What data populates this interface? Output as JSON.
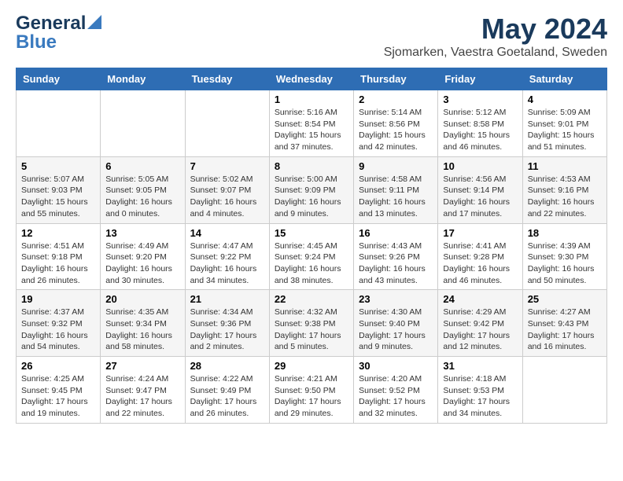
{
  "header": {
    "logo_general": "General",
    "logo_blue": "Blue",
    "main_title": "May 2024",
    "subtitle": "Sjomarken, Vaestra Goetaland, Sweden"
  },
  "weekdays": [
    "Sunday",
    "Monday",
    "Tuesday",
    "Wednesday",
    "Thursday",
    "Friday",
    "Saturday"
  ],
  "weeks": [
    [
      {
        "day": "",
        "info": ""
      },
      {
        "day": "",
        "info": ""
      },
      {
        "day": "",
        "info": ""
      },
      {
        "day": "1",
        "info": "Sunrise: 5:16 AM\nSunset: 8:54 PM\nDaylight: 15 hours and 37 minutes."
      },
      {
        "day": "2",
        "info": "Sunrise: 5:14 AM\nSunset: 8:56 PM\nDaylight: 15 hours and 42 minutes."
      },
      {
        "day": "3",
        "info": "Sunrise: 5:12 AM\nSunset: 8:58 PM\nDaylight: 15 hours and 46 minutes."
      },
      {
        "day": "4",
        "info": "Sunrise: 5:09 AM\nSunset: 9:01 PM\nDaylight: 15 hours and 51 minutes."
      }
    ],
    [
      {
        "day": "5",
        "info": "Sunrise: 5:07 AM\nSunset: 9:03 PM\nDaylight: 15 hours and 55 minutes."
      },
      {
        "day": "6",
        "info": "Sunrise: 5:05 AM\nSunset: 9:05 PM\nDaylight: 16 hours and 0 minutes."
      },
      {
        "day": "7",
        "info": "Sunrise: 5:02 AM\nSunset: 9:07 PM\nDaylight: 16 hours and 4 minutes."
      },
      {
        "day": "8",
        "info": "Sunrise: 5:00 AM\nSunset: 9:09 PM\nDaylight: 16 hours and 9 minutes."
      },
      {
        "day": "9",
        "info": "Sunrise: 4:58 AM\nSunset: 9:11 PM\nDaylight: 16 hours and 13 minutes."
      },
      {
        "day": "10",
        "info": "Sunrise: 4:56 AM\nSunset: 9:14 PM\nDaylight: 16 hours and 17 minutes."
      },
      {
        "day": "11",
        "info": "Sunrise: 4:53 AM\nSunset: 9:16 PM\nDaylight: 16 hours and 22 minutes."
      }
    ],
    [
      {
        "day": "12",
        "info": "Sunrise: 4:51 AM\nSunset: 9:18 PM\nDaylight: 16 hours and 26 minutes."
      },
      {
        "day": "13",
        "info": "Sunrise: 4:49 AM\nSunset: 9:20 PM\nDaylight: 16 hours and 30 minutes."
      },
      {
        "day": "14",
        "info": "Sunrise: 4:47 AM\nSunset: 9:22 PM\nDaylight: 16 hours and 34 minutes."
      },
      {
        "day": "15",
        "info": "Sunrise: 4:45 AM\nSunset: 9:24 PM\nDaylight: 16 hours and 38 minutes."
      },
      {
        "day": "16",
        "info": "Sunrise: 4:43 AM\nSunset: 9:26 PM\nDaylight: 16 hours and 43 minutes."
      },
      {
        "day": "17",
        "info": "Sunrise: 4:41 AM\nSunset: 9:28 PM\nDaylight: 16 hours and 46 minutes."
      },
      {
        "day": "18",
        "info": "Sunrise: 4:39 AM\nSunset: 9:30 PM\nDaylight: 16 hours and 50 minutes."
      }
    ],
    [
      {
        "day": "19",
        "info": "Sunrise: 4:37 AM\nSunset: 9:32 PM\nDaylight: 16 hours and 54 minutes."
      },
      {
        "day": "20",
        "info": "Sunrise: 4:35 AM\nSunset: 9:34 PM\nDaylight: 16 hours and 58 minutes."
      },
      {
        "day": "21",
        "info": "Sunrise: 4:34 AM\nSunset: 9:36 PM\nDaylight: 17 hours and 2 minutes."
      },
      {
        "day": "22",
        "info": "Sunrise: 4:32 AM\nSunset: 9:38 PM\nDaylight: 17 hours and 5 minutes."
      },
      {
        "day": "23",
        "info": "Sunrise: 4:30 AM\nSunset: 9:40 PM\nDaylight: 17 hours and 9 minutes."
      },
      {
        "day": "24",
        "info": "Sunrise: 4:29 AM\nSunset: 9:42 PM\nDaylight: 17 hours and 12 minutes."
      },
      {
        "day": "25",
        "info": "Sunrise: 4:27 AM\nSunset: 9:43 PM\nDaylight: 17 hours and 16 minutes."
      }
    ],
    [
      {
        "day": "26",
        "info": "Sunrise: 4:25 AM\nSunset: 9:45 PM\nDaylight: 17 hours and 19 minutes."
      },
      {
        "day": "27",
        "info": "Sunrise: 4:24 AM\nSunset: 9:47 PM\nDaylight: 17 hours and 22 minutes."
      },
      {
        "day": "28",
        "info": "Sunrise: 4:22 AM\nSunset: 9:49 PM\nDaylight: 17 hours and 26 minutes."
      },
      {
        "day": "29",
        "info": "Sunrise: 4:21 AM\nSunset: 9:50 PM\nDaylight: 17 hours and 29 minutes."
      },
      {
        "day": "30",
        "info": "Sunrise: 4:20 AM\nSunset: 9:52 PM\nDaylight: 17 hours and 32 minutes."
      },
      {
        "day": "31",
        "info": "Sunrise: 4:18 AM\nSunset: 9:53 PM\nDaylight: 17 hours and 34 minutes."
      },
      {
        "day": "",
        "info": ""
      }
    ]
  ]
}
